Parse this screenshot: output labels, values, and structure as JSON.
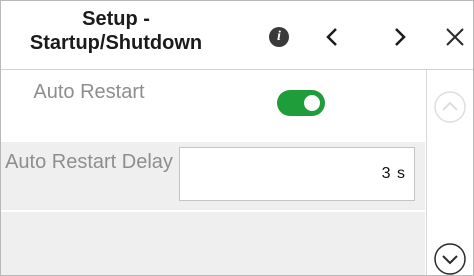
{
  "header": {
    "title": "Setup - Startup/Shutdown",
    "info_icon": "info-icon",
    "prev_icon": "chevron-left-icon",
    "next_icon": "chevron-right-icon",
    "close_icon": "close-icon"
  },
  "settings": [
    {
      "label": "Auto Restart",
      "control": "toggle",
      "enabled": true
    },
    {
      "label": "Auto Restart Delay",
      "control": "input",
      "value": "3 s"
    }
  ],
  "scroll": {
    "up_icon": "chevron-up-circle-icon",
    "up_enabled": false,
    "down_icon": "chevron-down-circle-icon",
    "down_enabled": true
  },
  "colors": {
    "toggle_on": "#1f9d3b",
    "label": "#8e8e8e",
    "row_alt": "#efefef"
  }
}
